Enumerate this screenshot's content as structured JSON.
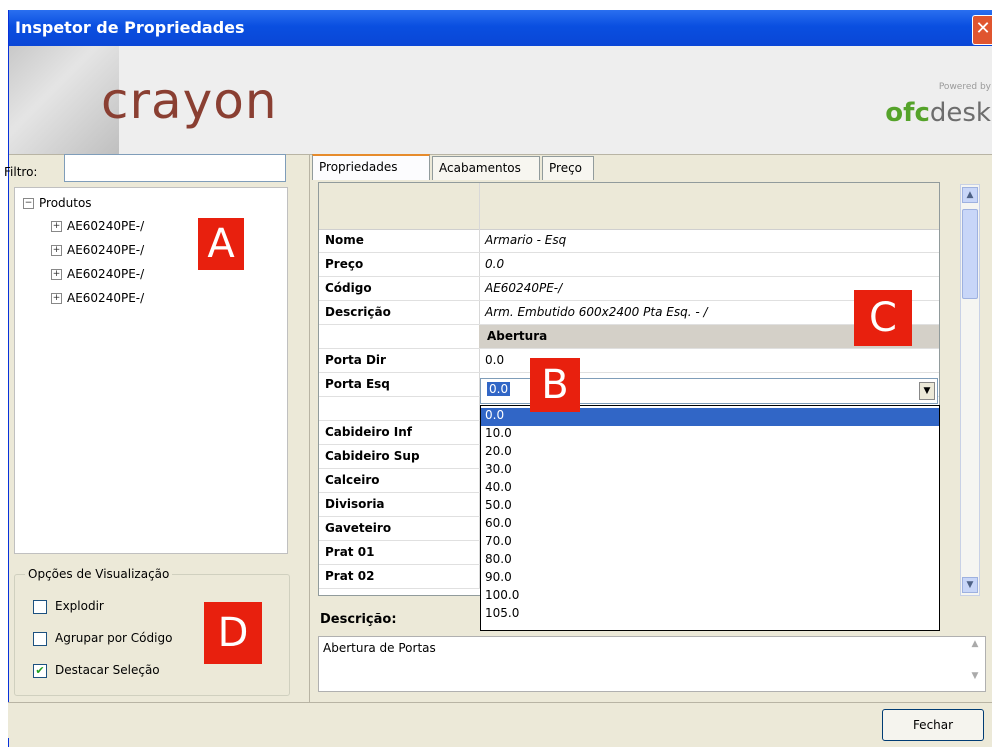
{
  "window": {
    "title": "Inspetor de Propriedades",
    "close": "✕"
  },
  "banner": {
    "brand": "crayon",
    "powered_by": "Powered by",
    "ofc_green": "ofc",
    "ofc_gray": "desk"
  },
  "filter": {
    "label": "Filtro:",
    "value": ""
  },
  "tree": {
    "root": "Produtos",
    "items": [
      "AE60240PE-/",
      "AE60240PE-/",
      "AE60240PE-/",
      "AE60240PE-/"
    ]
  },
  "options": {
    "title": "Opções de Visualização",
    "items": [
      {
        "label": "Explodir",
        "checked": false
      },
      {
        "label": "Agrupar por Código",
        "checked": false
      },
      {
        "label": "Destacar Seleção",
        "checked": true
      }
    ]
  },
  "tabs": [
    "Propriedades",
    "Acabamentos",
    "Preço"
  ],
  "properties": {
    "nome": {
      "name": "Nome",
      "value": "Armario - Esq"
    },
    "preco": {
      "name": "Preço",
      "value": "0.0"
    },
    "codigo": {
      "name": "Código",
      "value": "AE60240PE-/"
    },
    "descricao": {
      "name": "Descrição",
      "value": "Arm. Embutido 600x2400 Pta Esq. - /"
    },
    "section": "Abertura",
    "porta_dir": {
      "name": "Porta Dir",
      "value": "0.0"
    },
    "porta_esq": {
      "name": "Porta Esq",
      "value": "0.0"
    },
    "more": [
      "Cabideiro Inf",
      "Cabideiro Sup",
      "Calceiro",
      "Divisoria",
      "Gaveteiro",
      "Prat 01",
      "Prat 02"
    ]
  },
  "dropdown_options": [
    "0.0",
    "10.0",
    "20.0",
    "30.0",
    "40.0",
    "50.0",
    "60.0",
    "70.0",
    "80.0",
    "90.0",
    "100.0",
    "105.0"
  ],
  "description": {
    "label": "Descrição:",
    "text": "Abertura de Portas"
  },
  "buttons": {
    "close": "Fechar"
  },
  "markers": {
    "a": "A",
    "b": "B",
    "c": "C",
    "d": "D"
  },
  "colors": {
    "marker": "#e8200e",
    "selection": "#3166c6",
    "titlebar": "#0a4fe0"
  }
}
